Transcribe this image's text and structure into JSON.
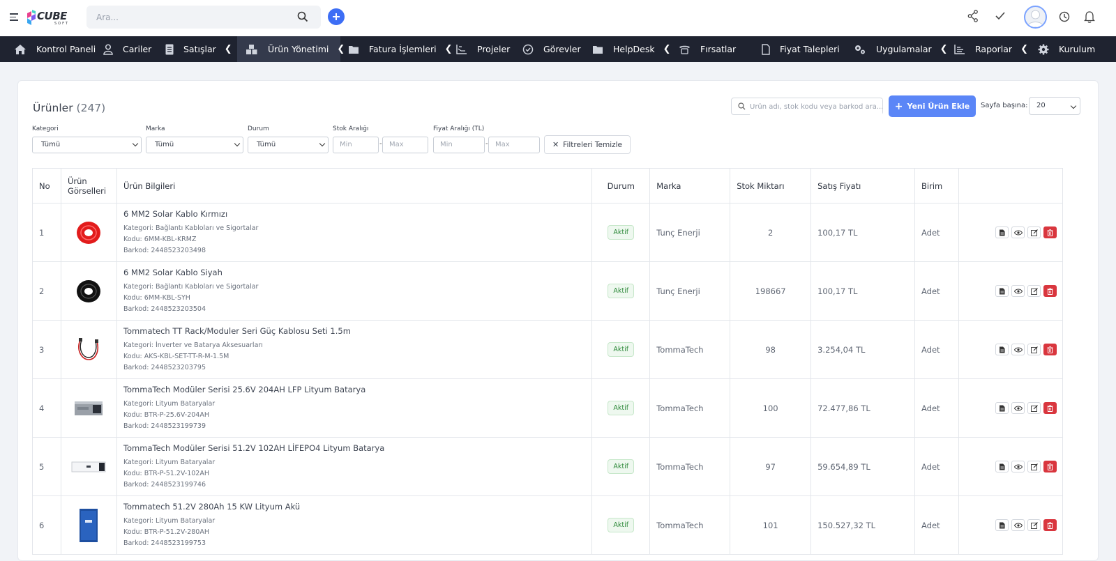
{
  "topbar": {
    "logo_text": "CUBE",
    "logo_sub": "SOFT",
    "search_placeholder": "Ara..."
  },
  "nav": [
    {
      "label": "Kontrol Paneli",
      "icon": "home-icon",
      "chevron": false
    },
    {
      "label": "Cariler",
      "icon": "user-icon",
      "chevron": false
    },
    {
      "label": "Satışlar",
      "icon": "document-icon",
      "chevron": true
    },
    {
      "label": "Ürün Yönetimi",
      "icon": "boxes-icon",
      "chevron": true,
      "active": true
    },
    {
      "label": "Fatura İşlemleri",
      "icon": "folder-icon",
      "chevron": true
    },
    {
      "label": "Projeler",
      "icon": "chart-icon",
      "chevron": false
    },
    {
      "label": "Görevler",
      "icon": "check-circle-icon",
      "chevron": false
    },
    {
      "label": "HelpDesk",
      "icon": "folder-icon",
      "chevron": true
    },
    {
      "label": "Fırsatlar",
      "icon": "phone-icon",
      "chevron": false
    },
    {
      "label": "Fiyat Talepleri",
      "icon": "file-icon",
      "chevron": false
    },
    {
      "label": "Uygulamalar",
      "icon": "gears-icon",
      "chevron": true
    },
    {
      "label": "Raporlar",
      "icon": "bar-chart-icon",
      "chevron": true
    },
    {
      "label": "Kurulum",
      "icon": "gear-icon",
      "chevron": false
    }
  ],
  "page": {
    "title": "Ürünler",
    "count": "(247)",
    "search_placeholder": "Ürün adı, stok kodu veya barkod ara...",
    "add_button": "Yeni Ürün Ekle",
    "per_page_label": "Sayfa başına:",
    "per_page_value": "20"
  },
  "filters": {
    "kategori_label": "Kategori",
    "kategori_value": "Tümü",
    "marka_label": "Marka",
    "marka_value": "Tümü",
    "durum_label": "Durum",
    "durum_value": "Tümü",
    "stok_label": "Stok Aralığı",
    "fiyat_label": "Fiyat Aralığı (TL)",
    "min_placeholder": "Min",
    "max_placeholder": "Max",
    "clear_button": "Filtreleri Temizle"
  },
  "table": {
    "headers": [
      "No",
      "Ürün Görselleri",
      "Ürün Bilgileri",
      "Durum",
      "Marka",
      "Stok Miktarı",
      "Satış Fiyatı",
      "Birim",
      ""
    ],
    "rows": [
      {
        "no": "1",
        "name": "6 MM2 Solar Kablo Kırmızı",
        "kategori": "Kategori: Bağlantı Kabloları ve Sigortalar",
        "kodu": "Kodu: 6MM-KBL-KRMZ",
        "barkod": "Barkod: 2448523203498",
        "durum": "Aktif",
        "marka": "Tunç Enerji",
        "stok": "2",
        "fiyat": "100,17 TL",
        "birim": "Adet",
        "thumb": "red-cable"
      },
      {
        "no": "2",
        "name": "6 MM2 Solar Kablo Siyah",
        "kategori": "Kategori: Bağlantı Kabloları ve Sigortalar",
        "kodu": "Kodu: 6MM-KBL-SYH",
        "barkod": "Barkod: 2448523203504",
        "durum": "Aktif",
        "marka": "Tunç Enerji",
        "stok": "198667",
        "fiyat": "100,17 TL",
        "birim": "Adet",
        "thumb": "black-cable"
      },
      {
        "no": "3",
        "name": "Tommatech TT Rack/Moduler Seri Güç Kablosu Seti 1.5m",
        "kategori": "Kategori: İnverter ve Batarya Aksesuarları",
        "kodu": "Kodu: AKS-KBL-SET-TT-R-M-1.5M",
        "barkod": "Barkod: 2448523203795",
        "durum": "Aktif",
        "marka": "TommaTech",
        "stok": "98",
        "fiyat": "3.254,04 TL",
        "birim": "Adet",
        "thumb": "power-cable"
      },
      {
        "no": "4",
        "name": "TommaTech Modüler Serisi 25.6V 204AH LFP Lityum Batarya",
        "kategori": "Kategori: Lityum Bataryalar",
        "kodu": "Kodu: BTR-P-25.6V-204AH",
        "barkod": "Barkod: 2448523199739",
        "durum": "Aktif",
        "marka": "TommaTech",
        "stok": "100",
        "fiyat": "72.477,86 TL",
        "birim": "Adet",
        "thumb": "battery-box"
      },
      {
        "no": "5",
        "name": "TommaTech Modüler Serisi 51.2V 102AH LİFEPO4 Lityum Batarya",
        "kategori": "Kategori: Lityum Bataryalar",
        "kodu": "Kodu: BTR-P-51.2V-102AH",
        "barkod": "Barkod: 2448523199746",
        "durum": "Aktif",
        "marka": "TommaTech",
        "stok": "97",
        "fiyat": "59.654,89 TL",
        "birim": "Adet",
        "thumb": "battery-flat"
      },
      {
        "no": "6",
        "name": "Tommatech 51.2V 280Ah 15 KW Lityum Akü",
        "kategori": "Kategori: Lityum Bataryalar",
        "kodu": "Kodu: BTR-P-51.2V-280AH",
        "barkod": "Barkod: 2448523199753",
        "durum": "Aktif",
        "marka": "TommaTech",
        "stok": "101",
        "fiyat": "150.527,32 TL",
        "birim": "Adet",
        "thumb": "battery-tower"
      }
    ]
  },
  "colors": {
    "navbar": "#1f2330",
    "accent": "#3d6ef5",
    "add_button": "#5b86f7",
    "delete": "#d9363e",
    "active_badge": "#2f8a3b"
  }
}
